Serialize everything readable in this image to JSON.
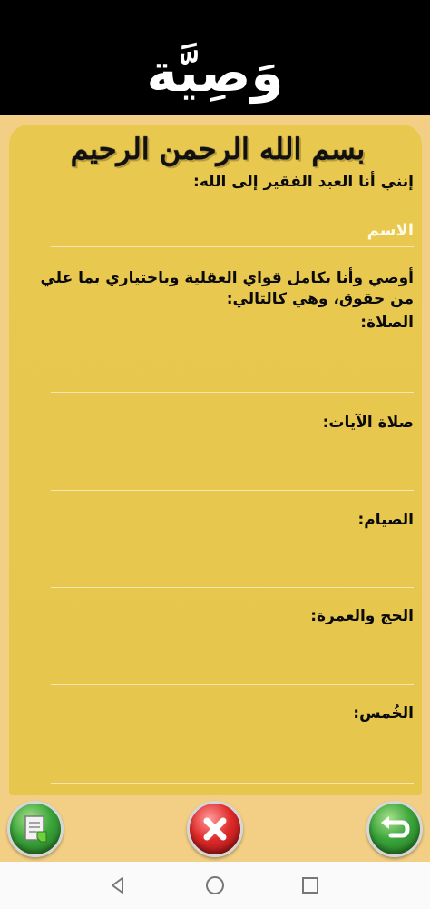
{
  "header": {
    "title": "وَصِيَّة"
  },
  "basmala": "بسم الله الرحمن الرحيم",
  "intro": "إنني أنا العبد الفقير إلى الله:",
  "name_input": {
    "placeholder": "الاسم",
    "value": ""
  },
  "will_text": "أوصي وأنا بكامل قواي العقلية وباختياري بما علي من حقوق، وهي كالتالي:",
  "sections": [
    {
      "label": "الصلاة:"
    },
    {
      "label": "صلاة الآيات:"
    },
    {
      "label": "الصيام:"
    },
    {
      "label": "الحج والعمرة:"
    },
    {
      "label": "الخُمس:"
    }
  ],
  "buttons": {
    "save_icon": "document-save-icon",
    "cancel_icon": "close-icon",
    "back_icon": "back-arrow-icon"
  },
  "nav": {
    "back": "nav-back-icon",
    "home": "nav-home-icon",
    "recents": "nav-recents-icon"
  },
  "colors": {
    "header_bg": "#000000",
    "page_bg": "#f2cf84",
    "paper": "#e7c64d"
  }
}
